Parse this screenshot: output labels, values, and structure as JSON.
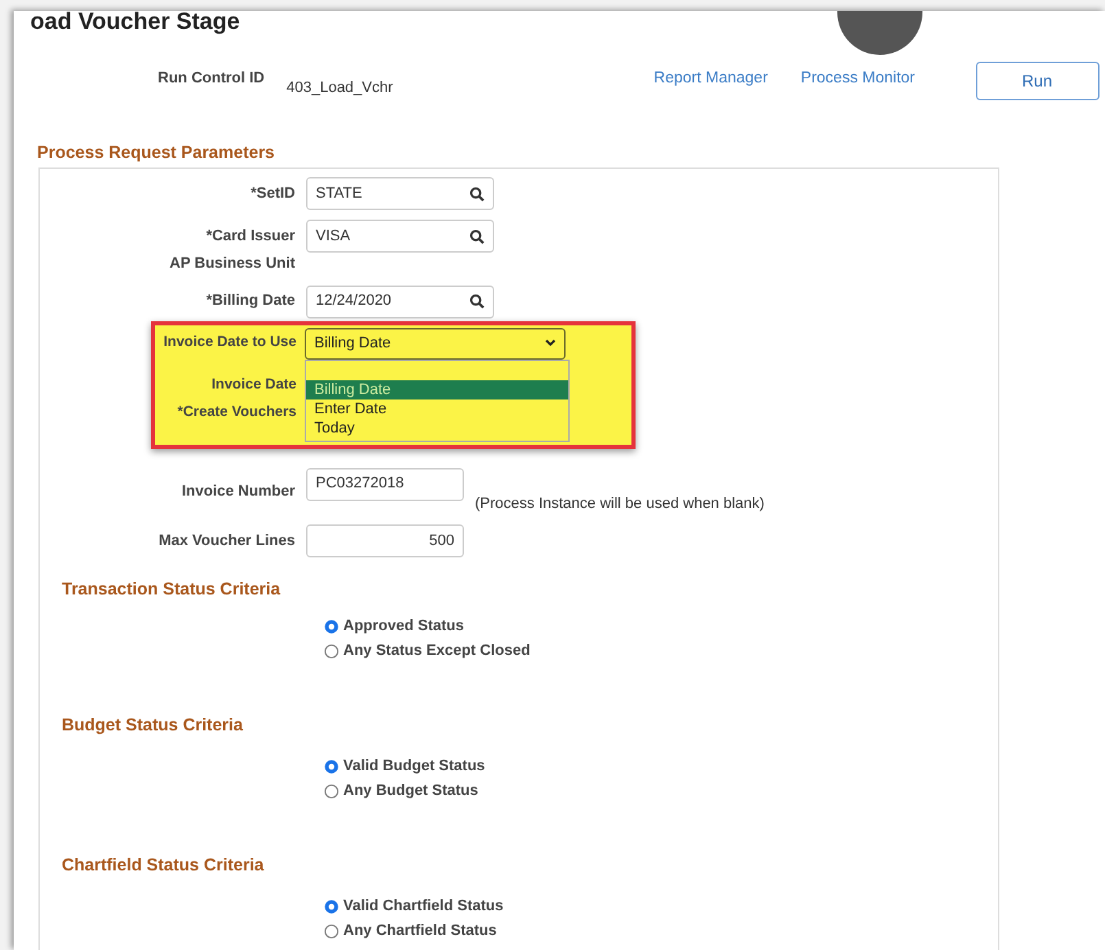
{
  "header": {
    "title": "oad Voucher Stage",
    "run_control_label": "Run Control ID",
    "run_control_id": "403_Load_Vchr",
    "links": [
      "Report Manager",
      "Process Monitor"
    ],
    "run_button": "Run"
  },
  "parameters": {
    "title": "Process Request Parameters",
    "fields": [
      {
        "kind": "lookup",
        "label": "*SetID",
        "value": "STATE"
      },
      {
        "kind": "lookup",
        "label": "*Card Issuer",
        "value": "VISA"
      },
      {
        "kind": "caption",
        "label": "AP Business Unit"
      },
      {
        "kind": "lookup",
        "label": "*Billing Date",
        "value": "12/24/2020"
      }
    ],
    "invoice_date": {
      "label": "Invoice Date to Use",
      "value": "Billing Date",
      "hidden_labels": [
        "Invoice Date",
        "*Create Vouchers"
      ],
      "options": [
        {
          "label": "Billing Date",
          "selected": true
        },
        {
          "label": "Enter Date",
          "selected": false
        },
        {
          "label": "Today",
          "selected": false
        }
      ]
    },
    "more_fields": [
      {
        "kind": "text",
        "label": "Invoice Number",
        "value": "PC03272018",
        "note": "(Process Instance will be used when blank)"
      },
      {
        "kind": "number",
        "label": "Max Voucher Lines",
        "value": "500"
      }
    ],
    "criteria": [
      {
        "title": "Transaction Status Criteria",
        "options": [
          {
            "label": "Approved Status",
            "selected": true
          },
          {
            "label": "Any Status Except Closed",
            "selected": false
          }
        ]
      },
      {
        "title": "Budget Status Criteria",
        "options": [
          {
            "label": "Valid Budget Status",
            "selected": true
          },
          {
            "label": "Any Budget Status",
            "selected": false
          }
        ]
      },
      {
        "title": "Chartfield Status Criteria",
        "options": [
          {
            "label": "Valid Chartfield Status",
            "selected": true
          },
          {
            "label": "Any Chartfield Status",
            "selected": false
          }
        ]
      }
    ]
  }
}
